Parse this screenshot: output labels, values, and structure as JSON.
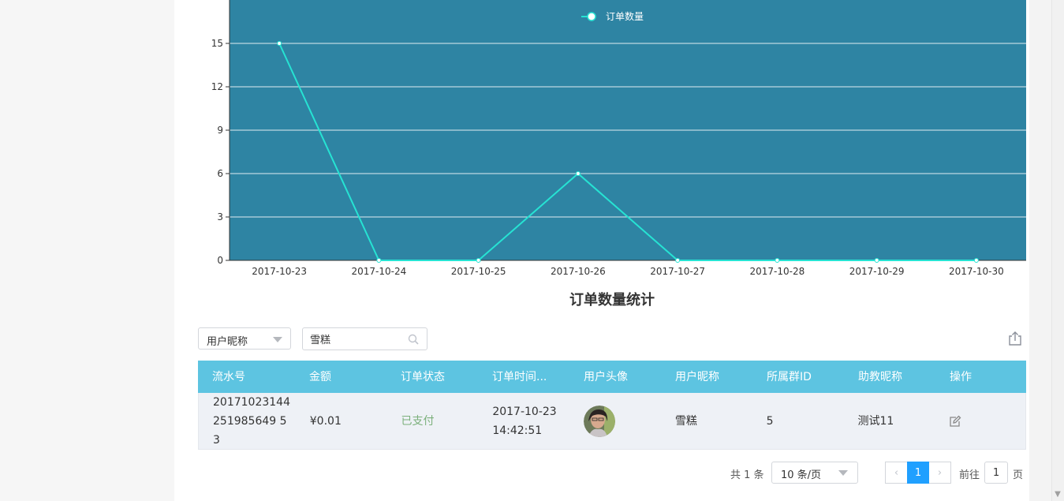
{
  "chart_data": {
    "type": "line",
    "title": "订单数量统计",
    "legend": "订单数量",
    "legend_position": "top-center",
    "categories": [
      "2017-10-23",
      "2017-10-24",
      "2017-10-25",
      "2017-10-26",
      "2017-10-27",
      "2017-10-28",
      "2017-10-29",
      "2017-10-30"
    ],
    "series": [
      {
        "name": "订单数量",
        "values": [
          15,
          0,
          0,
          6,
          0,
          0,
          0,
          0
        ]
      }
    ],
    "yticks": [
      "0",
      "3",
      "6",
      "9",
      "12",
      "15"
    ],
    "ylim": [
      0,
      18
    ],
    "grid": true,
    "colors": {
      "background": "#2e84a3",
      "line": "#26e3d3",
      "grid": "#ffffff",
      "axis": "#333333"
    }
  },
  "filter": {
    "field_select": "用户昵称",
    "search_value": "雪糕"
  },
  "table": {
    "headers": [
      "流水号",
      "金额",
      "订单状态",
      "订单时间...",
      "用户头像",
      "用户昵称",
      "所属群ID",
      "助教昵称",
      "操作"
    ],
    "rows": [
      {
        "serial": "201710231442519856495 3",
        "serial_display": "20171023144251985649 53",
        "amount": "¥0.01",
        "status": "已支付",
        "time_date": "2017-10-23",
        "time_clock": "14:42:51",
        "nickname": "雪糕",
        "group_id": "5",
        "assistant": "测试11"
      }
    ]
  },
  "pagination": {
    "total": "共 1 条",
    "page_size": "10 条/页",
    "current_page": "1",
    "goto_label": "前往",
    "goto_value": "1",
    "page_label": "页"
  },
  "icons": {
    "search": "search-icon",
    "export": "export-icon",
    "edit": "edit-icon",
    "prev": "chevron-left-icon",
    "next": "chevron-right-icon"
  }
}
